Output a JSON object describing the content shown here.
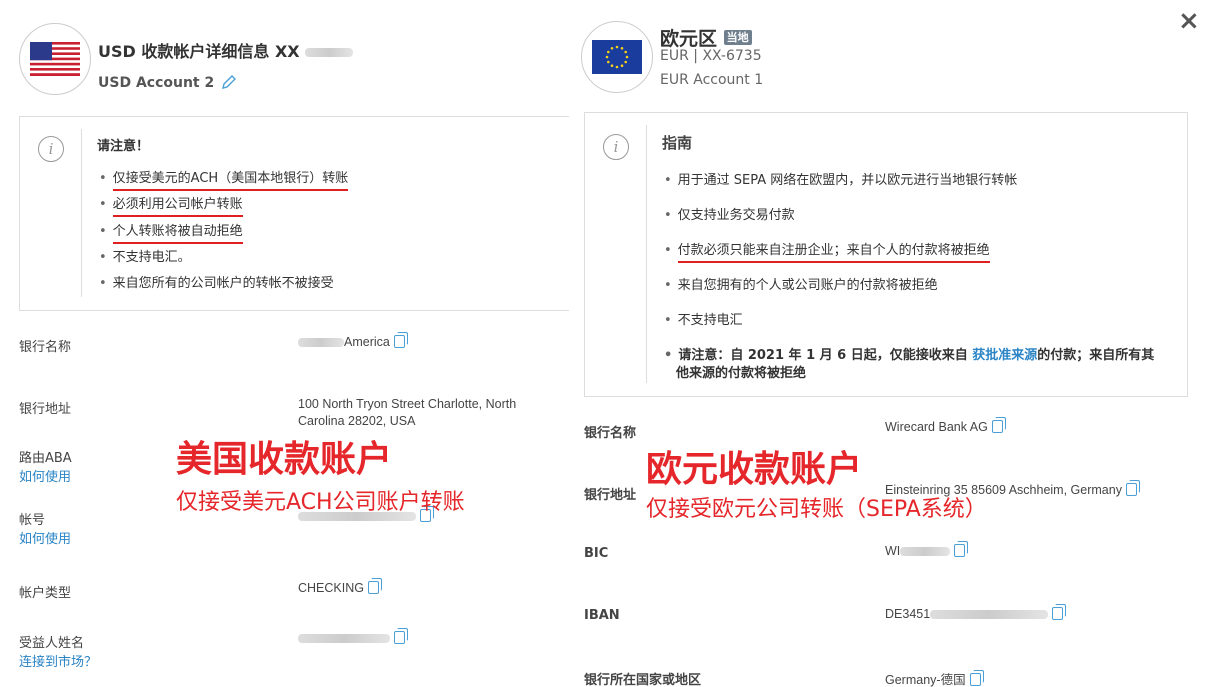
{
  "usd": {
    "title": "USD 收款帐户详细信息 XX",
    "account_name": "USD Account 2",
    "notice_title": "请注意！",
    "notices": [
      "仅接受美元的ACH（美国本地银行）转账",
      "必须利用公司帐户转账",
      "个人转账将被自动拒绝",
      "不支持电汇。",
      "来自您所有的公司帐户的转帐不被接受"
    ],
    "fields": {
      "bank_name_label": "银行名称",
      "bank_name_value": "America",
      "bank_address_label": "银行地址",
      "bank_address_line1": "100 North Tryon Street Charlotte, North",
      "bank_address_line2": "Carolina 28202, USA",
      "routing_label": "路由ABA",
      "routing_help": "如何使用",
      "account_no_label": "帐号",
      "account_no_help": "如何使用",
      "account_type_label": "帐户类型",
      "account_type_value": "CHECKING",
      "beneficiary_label": "受益人姓名",
      "beneficiary_link": "连接到市场？"
    },
    "overlay_big": "美国收款账户",
    "overlay_small": "仅接受美元ACH公司账户转账"
  },
  "eur": {
    "title": "欧元区",
    "tag": "当地",
    "subtitle": "EUR | XX-6735",
    "account_name": "EUR Account 1",
    "guide_title": "指南",
    "guides": [
      "用于通过 SEPA 网络在欧盟内，并以欧元进行当地银行转帐",
      "仅支持业务交易付款",
      "付款必须只能来自注册企业；来自个人的付款将被拒绝",
      "来自您拥有的个人或公司账户的付款将被拒绝",
      "不支持电汇"
    ],
    "guide_note_a": "请注意：自 2021 年 1 月 6 日起，仅能接收来自 ",
    "guide_note_link": "获批准来源",
    "guide_note_b": "的付款；来自所有其",
    "guide_note_c": "他来源的付款将被拒绝",
    "fields": {
      "bank_name_label": "银行名称",
      "bank_name_value": "Wirecard Bank AG",
      "bank_address_label": "银行地址",
      "bank_address_value": "Einsteinring 35 85609 Aschheim, Germany",
      "bic_label": "BIC",
      "bic_value": "WI",
      "iban_label": "IBAN",
      "iban_value": "DE3451",
      "country_label": "银行所在国家或地区",
      "country_value": "Germany-德国"
    },
    "overlay_big": "欧元收款账户",
    "overlay_small": "仅接受欧元公司转账（SEPA系统）"
  },
  "close_label": "×",
  "icons": [
    "us-flag-icon",
    "eu-flag-icon",
    "edit-pencil-icon",
    "info-icon",
    "copy-icon",
    "close-icon"
  ]
}
